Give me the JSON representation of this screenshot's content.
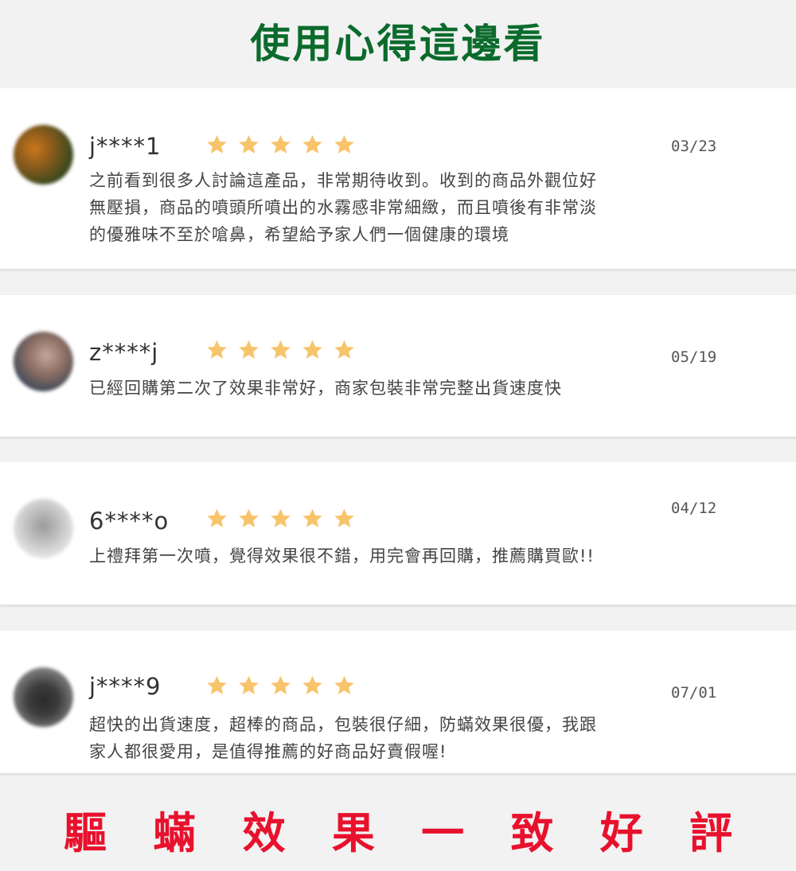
{
  "header": {
    "title": "使用心得這邊看"
  },
  "reviews": [
    {
      "username": "j****1",
      "rating": 5,
      "date": "03/23",
      "text_lines": [
        "之前看到很多人討論這產品，非常期待收到。收到的商品外觀位好",
        "無壓損，商品的噴頭所噴出的水霧感非常細緻，而且噴後有非常淡",
        "的優雅味不至於嗆鼻，希望給予家人們一個健康的環境"
      ]
    },
    {
      "username": "z****j",
      "rating": 5,
      "date": "05/19",
      "text_lines": [
        "已經回購第二次了效果非常好，商家包裝非常完整出貨速度快"
      ]
    },
    {
      "username": "6****o",
      "rating": 5,
      "date": "04/12",
      "text_lines": [
        "上禮拜第一次噴，覺得效果很不錯，用完會再回購，推薦購買歐!!"
      ]
    },
    {
      "username": "j****9",
      "rating": 5,
      "date": "07/01",
      "text_lines": [
        "超快的出貨速度，超棒的商品，包裝很仔細，防蟎效果很優，我跟",
        "家人都很愛用，是值得推薦的好商品好賣假喔!"
      ]
    }
  ],
  "footer": {
    "slogan_chars": [
      "驅",
      "蟎",
      "效",
      "果",
      "一",
      "致",
      "好",
      "評"
    ]
  },
  "colors": {
    "title_green": "#0b6b2c",
    "slogan_red": "#e8112d",
    "star_gold": "#f7c46c"
  },
  "icons": {
    "star": "star-icon",
    "avatar": "avatar"
  }
}
